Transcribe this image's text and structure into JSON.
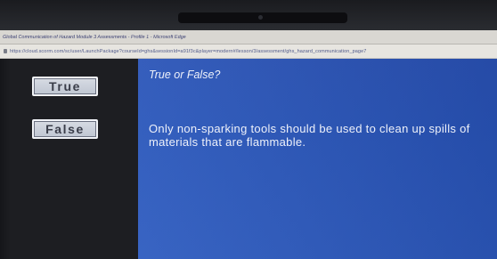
{
  "browser": {
    "title_text": "Global Communication of Hazard Module 3 Assessments - Profile 1 - Microsoft Edge",
    "url": "https://cloud.scorm.com/sc/user/LaunchPackage?courseId=ghs&sessionId=a91f3c&player=modern#/lesson/3/assessment/ghs_hazard_communication_page7"
  },
  "answers": {
    "true_label": "True",
    "false_label": "False"
  },
  "question": {
    "heading": "True or False?",
    "statement": "Only non-sparking tools should be used to clean up spills of materials that are flammable."
  },
  "colors": {
    "content_bg": "#2b55b8",
    "left_bg": "#1d1e22",
    "button_bg": "#ccd2dc"
  }
}
